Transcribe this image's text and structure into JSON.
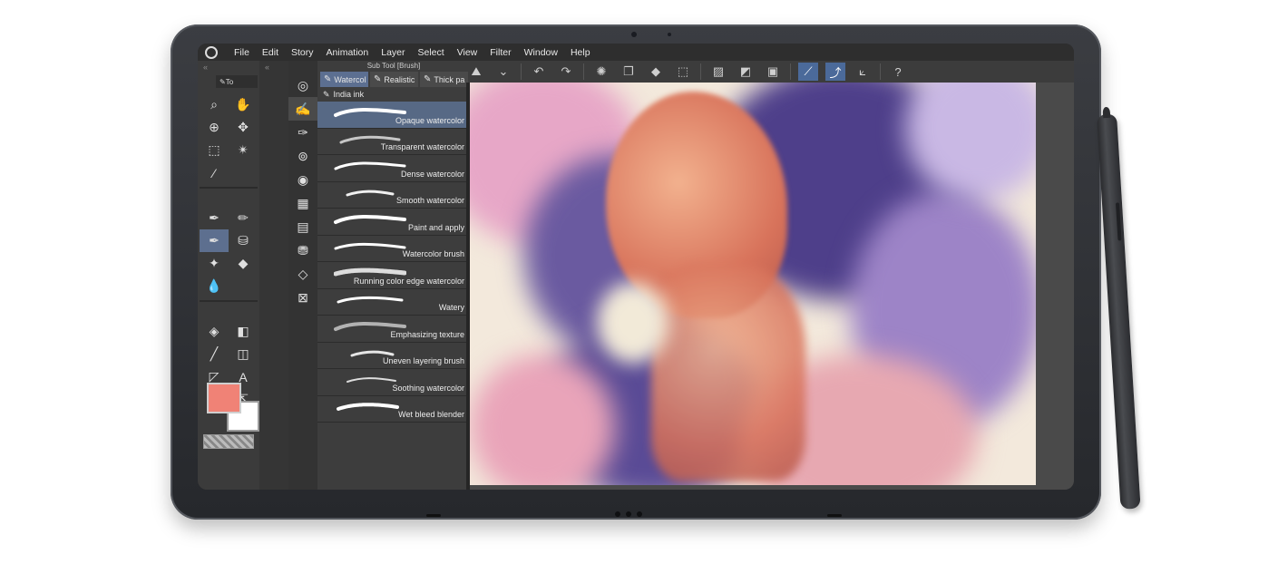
{
  "menu": {
    "items": [
      "File",
      "Edit",
      "Story",
      "Animation",
      "Layer",
      "Select",
      "View",
      "Filter",
      "Window",
      "Help"
    ]
  },
  "tool_panel": {
    "tab_label": "To",
    "collapse_left": "«",
    "collapse_right": "«"
  },
  "sub_tool": {
    "title": "Sub Tool [Brush]",
    "tabs": [
      {
        "label": "Watercol",
        "active": true
      },
      {
        "label": "Realistic",
        "active": false
      },
      {
        "label": "Thick pa",
        "active": false
      }
    ],
    "india_ink": "India ink",
    "brushes": [
      {
        "name": "Opaque watercolor",
        "selected": true
      },
      {
        "name": "Transparent watercolor",
        "selected": false
      },
      {
        "name": "Dense watercolor",
        "selected": false
      },
      {
        "name": "Smooth watercolor",
        "selected": false
      },
      {
        "name": "Paint and apply",
        "selected": false
      },
      {
        "name": "Watercolor brush",
        "selected": false
      },
      {
        "name": "Running color edge watercolor",
        "selected": false
      },
      {
        "name": "Watery",
        "selected": false
      },
      {
        "name": "Emphasizing texture",
        "selected": false
      },
      {
        "name": "Uneven layering brush",
        "selected": false
      },
      {
        "name": "Soothing watercolor",
        "selected": false
      },
      {
        "name": "Wet bleed blender",
        "selected": false
      }
    ]
  },
  "colors": {
    "main": "#f08276",
    "sub": "#ffffff",
    "accent": "#5c6f91"
  },
  "toolbar_icons": [
    "zoom-tool-icon",
    "dropdown-icon",
    "undo-icon",
    "redo-icon",
    "loading-icon",
    "copy-icon",
    "fill-icon",
    "transform-icon",
    "clear-icon",
    "gradient-icon",
    "frame-icon",
    "stabilizer-icon",
    "pen-pressure-icon",
    "ruler-icon",
    "help-icon"
  ]
}
